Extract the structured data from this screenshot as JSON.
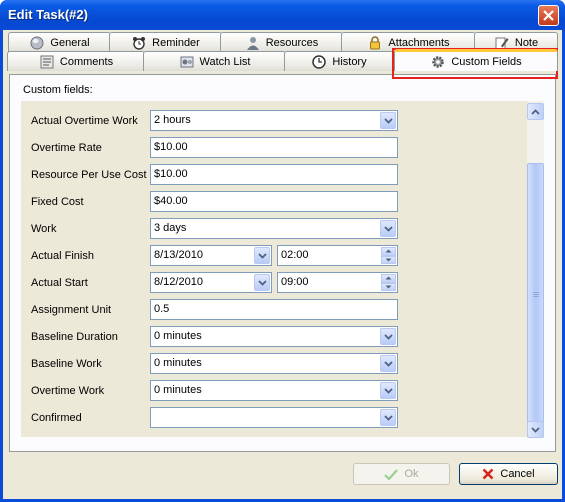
{
  "window": {
    "title": "Edit Task(#2)"
  },
  "tabs_row1": [
    {
      "label": "General",
      "icon": "globe-icon"
    },
    {
      "label": "Reminder",
      "icon": "alarm-clock-icon"
    },
    {
      "label": "Resources",
      "icon": "person-icon"
    },
    {
      "label": "Attachments",
      "icon": "padlock-icon"
    },
    {
      "label": "Note",
      "icon": "note-pencil-icon"
    }
  ],
  "tabs_row2": [
    {
      "label": "Comments",
      "icon": "comments-icon"
    },
    {
      "label": "Watch List",
      "icon": "watch-list-icon"
    },
    {
      "label": "History",
      "icon": "history-clock-icon"
    },
    {
      "label": "Custom Fields",
      "icon": "gear-icon",
      "active": true
    }
  ],
  "section": {
    "label": "Custom fields:"
  },
  "fields": [
    {
      "label": "Actual Overtime Work",
      "type": "dropdown",
      "value": "2 hours"
    },
    {
      "label": "Overtime Rate",
      "type": "text",
      "value": "$10.00"
    },
    {
      "label": "Resource Per Use Cost",
      "type": "text",
      "value": "$10.00"
    },
    {
      "label": "Fixed Cost",
      "type": "text",
      "value": "$40.00"
    },
    {
      "label": "Work",
      "type": "dropdown",
      "value": "3 days"
    },
    {
      "label": "Actual Finish",
      "type": "datetime",
      "date": "8/13/2010",
      "time": "02:00"
    },
    {
      "label": "Actual Start",
      "type": "datetime",
      "date": "8/12/2010",
      "time": "09:00"
    },
    {
      "label": "Assignment Unit",
      "type": "text",
      "value": "0.5"
    },
    {
      "label": "Baseline Duration",
      "type": "dropdown",
      "value": "0 minutes"
    },
    {
      "label": "Baseline Work",
      "type": "dropdown",
      "value": "0 minutes"
    },
    {
      "label": "Overtime Work",
      "type": "dropdown",
      "value": "0 minutes"
    },
    {
      "label": "Confirmed",
      "type": "dropdown",
      "value": ""
    }
  ],
  "buttons": {
    "ok": "Ok",
    "cancel": "Cancel"
  },
  "colors": {
    "title_bar": "#0a4bd8",
    "dialog_bg": "#ece9d8",
    "active_tab_accent": "#ffc83c",
    "highlight": "#e82020",
    "cancel_x": "#d2261c",
    "ok_check_disabled": "#9ccf8f"
  }
}
